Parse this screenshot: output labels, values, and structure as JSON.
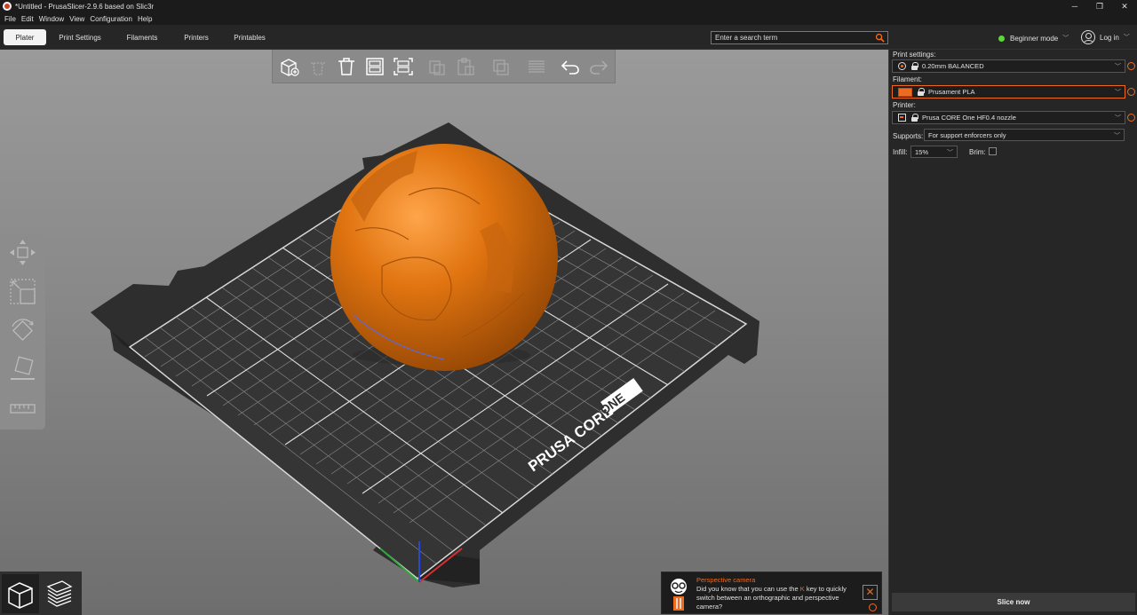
{
  "window": {
    "title": "*Untitled - PrusaSlicer-2.9.6 based on Slic3r",
    "controls": [
      "─",
      "❐",
      "✕"
    ]
  },
  "menu": [
    "File",
    "Edit",
    "Window",
    "View",
    "Configuration",
    "Help"
  ],
  "tabs": [
    {
      "label": "Plater",
      "active": true
    },
    {
      "label": "Print Settings",
      "active": false
    },
    {
      "label": "Filaments",
      "active": false
    },
    {
      "label": "Printers",
      "active": false
    },
    {
      "label": "Printables",
      "active": false
    }
  ],
  "search": {
    "placeholder": "Enter a search term"
  },
  "mode": {
    "label": "Beginner mode",
    "color": "#5cd63a"
  },
  "login": {
    "label": "Log in"
  },
  "toolbar_icons": [
    "add-icon",
    "delete-icon",
    "delete-all-icon",
    "arrange-icon",
    "arrange-selection-icon",
    "copy-icon",
    "paste-icon",
    "add-instance-icon",
    "split-icon",
    "layers-editing-icon",
    "undo-icon",
    "redo-icon"
  ],
  "gizmo_icons": [
    "move-icon",
    "scale-icon",
    "rotate-icon",
    "place-on-face-icon",
    "measure-icon"
  ],
  "bed": {
    "brand_left": "PRUSA CORE",
    "brand_right": "ONE"
  },
  "object": {
    "color": "#e07410"
  },
  "hint": {
    "title": "Perspective camera",
    "body_before": "Did you know that you can use the ",
    "key": "K",
    "body_after": " key to quickly switch between an orthographic and perspective camera?"
  },
  "sidebar": {
    "print_label": "Print settings:",
    "print_value": "0.20mm BALANCED",
    "filament_label": "Filament:",
    "filament_value": "Prusament PLA",
    "filament_color": "#ed6b21",
    "printer_label": "Printer:",
    "printer_value": "Prusa CORE One HF0.4 nozzle",
    "supports_label": "Supports:",
    "supports_value": "For support enforcers only",
    "infill_label": "Infill:",
    "infill_value": "15%",
    "brim_label": "Brim:",
    "brim_checked": false,
    "slice_label": "Slice now"
  },
  "accent_color": "#ed6b21"
}
